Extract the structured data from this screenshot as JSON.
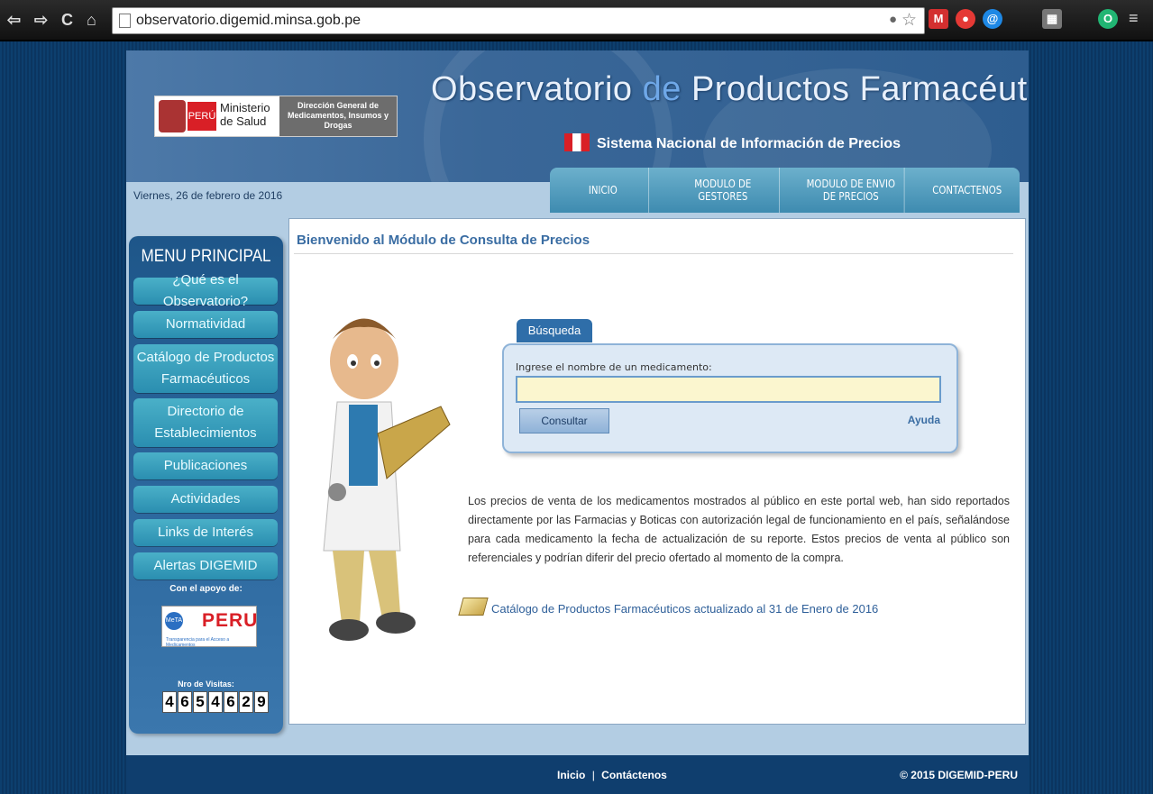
{
  "browser": {
    "url": "observatorio.digemid.minsa.gob.pe",
    "extensions": [
      {
        "name": "gmail-icon",
        "color": "#d32f2f",
        "text": "M"
      },
      {
        "name": "adblock-icon",
        "color": "#e53935",
        "text": "●"
      },
      {
        "name": "ext-a-icon",
        "color": "#1e88e5",
        "text": "@"
      },
      {
        "name": "qr-icon",
        "color": "#777777",
        "text": "▦"
      },
      {
        "name": "ext-o-icon",
        "color": "#21b573",
        "text": "O"
      }
    ]
  },
  "header": {
    "title_part1": "Observatorio",
    "title_de": "de",
    "title_part2": "Productos Farmacéuticos",
    "subtitle": "Sistema Nacional de Información de Precios",
    "logo_peru": "PERÚ",
    "logo_ministry": "Ministerio de Salud",
    "logo_dg": "Dirección General de Medicamentos, Insumos y Drogas",
    "date": "Viernes, 26 de febrero de 2016"
  },
  "topnav": [
    "INICIO",
    "MODULO DE GESTORES",
    "MODULO DE ENVIO DE PRECIOS",
    "CONTACTENOS"
  ],
  "sidebar": {
    "title": "MENU PRINCIPAL",
    "items": [
      "¿Qué es el Observatorio?",
      "Normatividad",
      "Catálogo de Productos Farmacéuticos",
      "Directorio de Establecimientos",
      "Publicaciones",
      "Actividades",
      "Links de Interés",
      "Alertas DIGEMID"
    ],
    "support_label": "Con el apoyo de:",
    "support_logo": {
      "meta": "MeTA",
      "peru": "PERU",
      "tagline": "Transparencia para el Acceso a Medicamentos"
    },
    "visits_label": "Nro de Visitas:",
    "visits_digits": [
      "4",
      "6",
      "5",
      "4",
      "6",
      "2",
      "9"
    ]
  },
  "main": {
    "welcome": "Bienvenido al Módulo de Consulta de Precios",
    "search": {
      "tab": "Búsqueda",
      "label": "Ingrese el nombre de un medicamento:",
      "input_value": "",
      "button": "Consultar",
      "help": "Ayuda"
    },
    "paragraph": "Los precios de venta de los medicamentos mostrados al público en este portal web, han sido reportados directamente por las Farmacias y Boticas con autorización legal de funcionamiento en el país, señalándose para cada medicamento la fecha de actualización de su reporte. Estos precios de venta al público son referenciales y podrían diferir del precio ofertado al momento de la compra.",
    "catalog_link": "Catálogo de Productos Farmacéuticos actualizado al 31 de Enero de 2016"
  },
  "footer": {
    "links": [
      "Inicio",
      "Contáctenos"
    ],
    "separator": "|",
    "copyright": "© 2015 DIGEMID-PERU"
  }
}
